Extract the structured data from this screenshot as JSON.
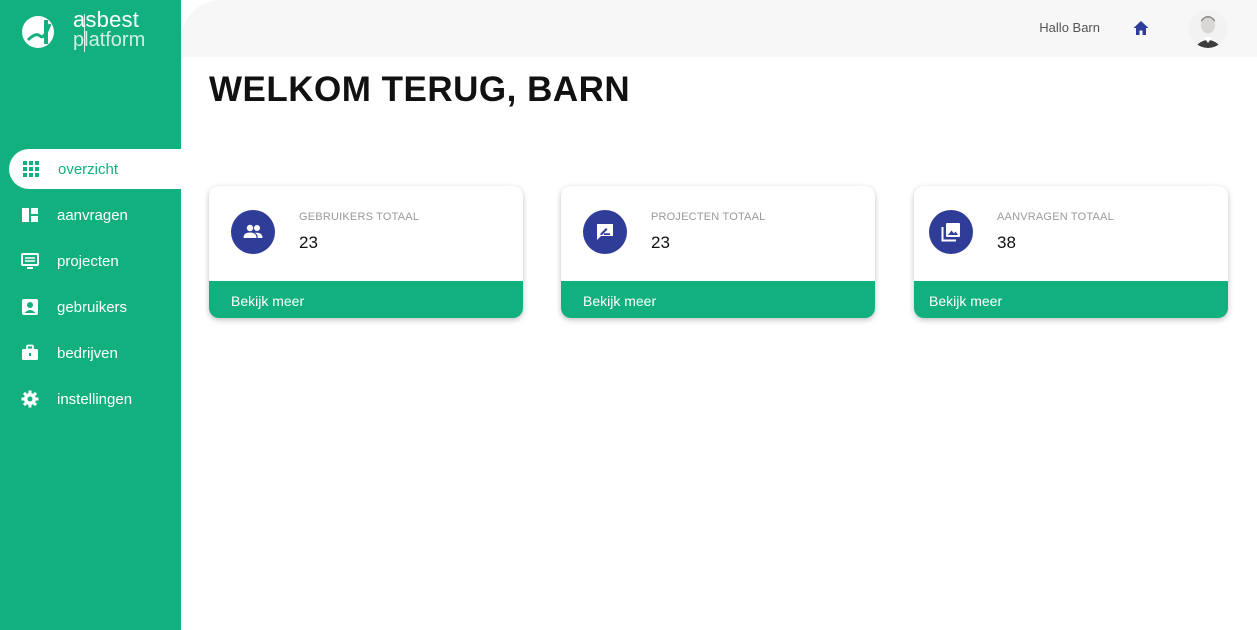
{
  "brand": {
    "line1": "asbest",
    "line2": "platform",
    "color": "#12b07f",
    "accent": "#2f3d98"
  },
  "sidebar": {
    "items": [
      {
        "label": "overzicht",
        "icon": "grid-icon",
        "active": true
      },
      {
        "label": "aanvragen",
        "icon": "dashboard-icon"
      },
      {
        "label": "projecten",
        "icon": "monitor-icon"
      },
      {
        "label": "gebruikers",
        "icon": "contact-card-icon"
      },
      {
        "label": "bedrijven",
        "icon": "briefcase-icon"
      },
      {
        "label": "instellingen",
        "icon": "gear-icon"
      }
    ]
  },
  "topbar": {
    "greeting": "Hallo Barn",
    "home_icon": "home-icon",
    "avatar_icon": "user-avatar"
  },
  "main": {
    "title": "WELKOM TERUG, BARN",
    "cards": [
      {
        "label": "GEBRUIKERS TOTAAL",
        "value": "23",
        "link": "Bekijk meer",
        "icon": "users-icon"
      },
      {
        "label": "PROJECTEN TOTAAL",
        "value": "23",
        "link": "Bekijk meer",
        "icon": "rate-review-icon"
      },
      {
        "label": "AANVRAGEN TOTAAL",
        "value": "38",
        "link": "Bekijk meer",
        "icon": "photo-library-icon"
      }
    ]
  }
}
